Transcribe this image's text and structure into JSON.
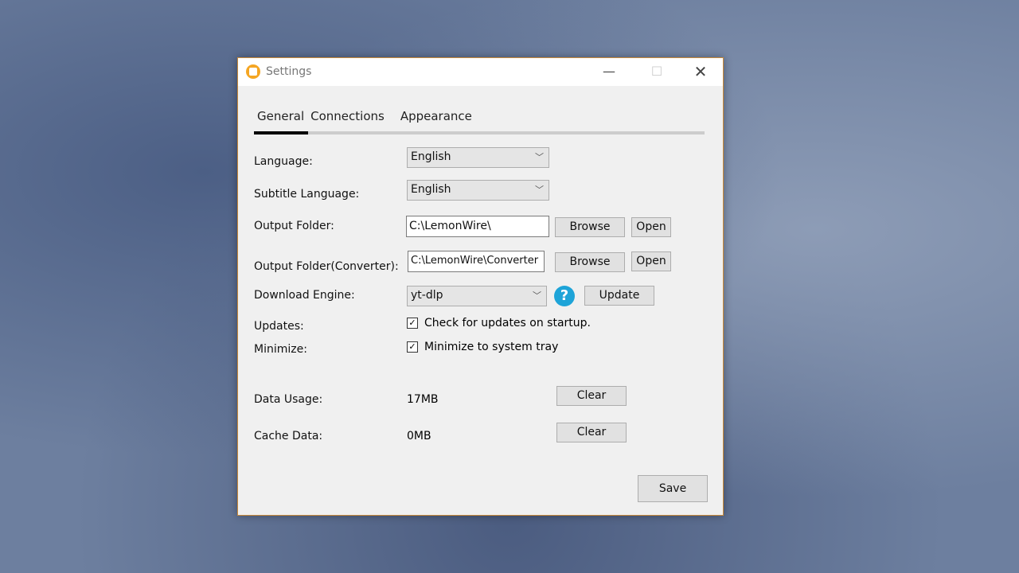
{
  "window": {
    "title": "Settings",
    "logo_icon": "lemonwire-logo",
    "accent": "#f5a623"
  },
  "tabs": [
    {
      "label": "General",
      "active": true
    },
    {
      "label": "Connections"
    },
    {
      "label": "Appearance"
    }
  ],
  "general": {
    "language": {
      "label": "Language:",
      "value": "English"
    },
    "subtitle_language": {
      "label": "Subtitle Language:",
      "value": "English"
    },
    "output_folder": {
      "label": "Output Folder:",
      "value": "C:\\LemonWire\\",
      "browse": "Browse",
      "open": "Open"
    },
    "output_folder_converter": {
      "label": "Output Folder(Converter):",
      "value": "C:\\LemonWire\\Converter",
      "browse": "Browse",
      "open": "Open"
    },
    "download_engine": {
      "label": "Download Engine:",
      "value": "yt-dlp",
      "help": "?",
      "update": "Update"
    },
    "updates": {
      "label": "Updates:",
      "checkbox": "Check for updates on startup.",
      "checked": true
    },
    "minimize": {
      "label": "Minimize:",
      "checkbox": "Minimize to system tray",
      "checked": true
    },
    "data_usage": {
      "label": "Data Usage:",
      "value": "17MB",
      "clear": "Clear"
    },
    "cache_data": {
      "label": "Cache Data:",
      "value": "0MB",
      "clear": "Clear"
    }
  },
  "save": "Save"
}
